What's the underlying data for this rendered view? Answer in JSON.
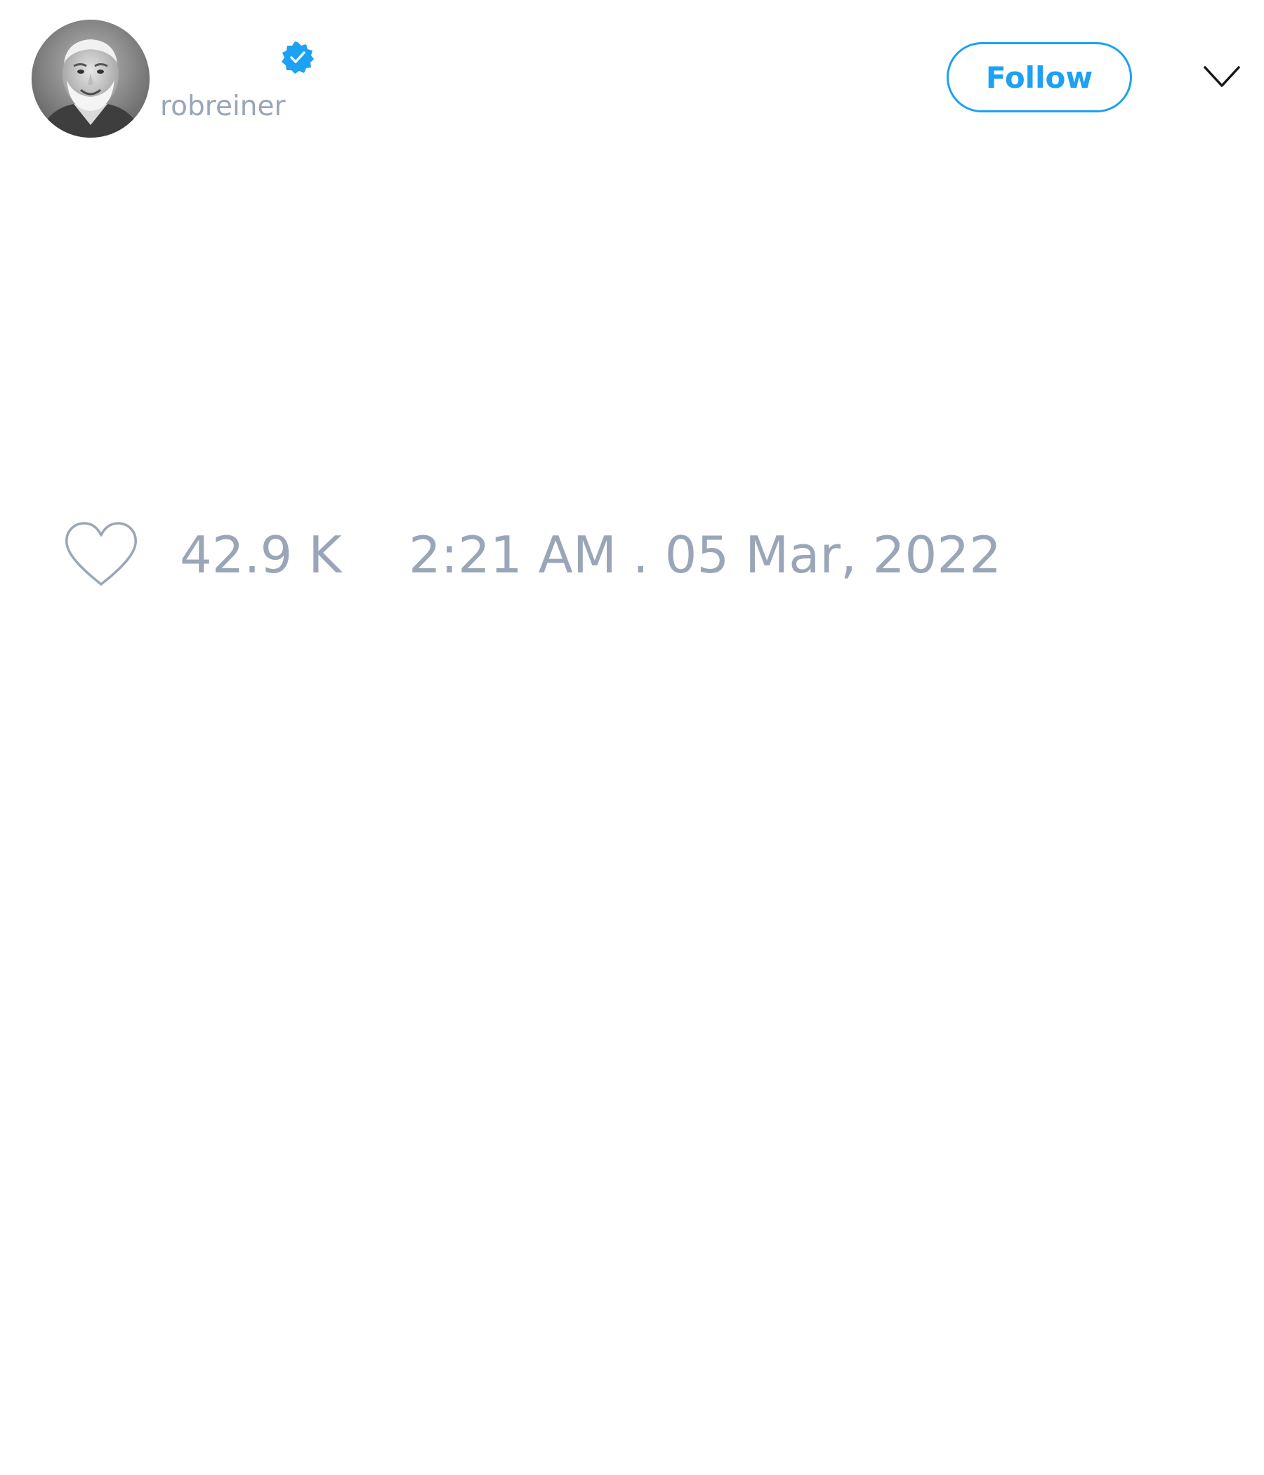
{
  "tweet": {
    "author": {
      "display_name": "",
      "handle": "robreiner",
      "verified": true,
      "avatar_icon": "avatar-photo"
    },
    "follow_label": "Follow",
    "menu_icon": "chevron-down-icon",
    "like_icon": "heart-outline-icon",
    "like_count": "42.9 K",
    "timestamp": "2:21 AM . 05 Mar, 2022"
  },
  "colors": {
    "accent": "#1da1f2",
    "muted_text": "#9aa6b8",
    "background": "#ffffff"
  }
}
